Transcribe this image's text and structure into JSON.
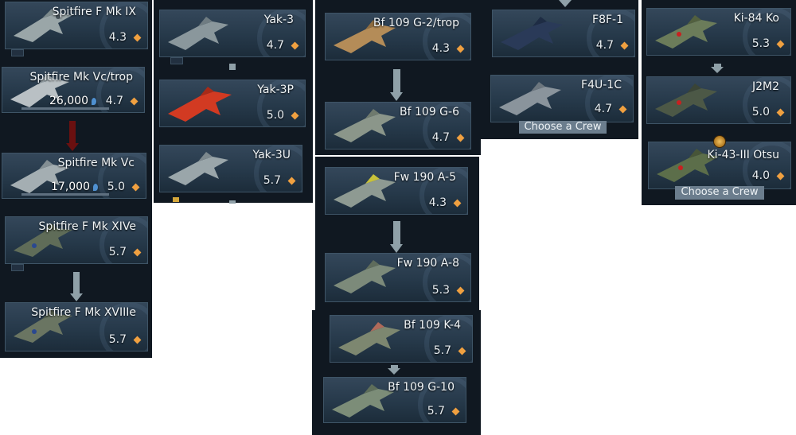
{
  "colors": {
    "panel_bg": "#101821",
    "card_bg": "#2a3c4d",
    "diamond": "#f0a040",
    "arrow": "#8fa0a8",
    "arrow_researching": "#6a1010",
    "crew_button": "#6b7d8d"
  },
  "icons": {
    "br": "diamond-icon",
    "research_point": "research-point-icon"
  },
  "columns": {
    "britain": [
      {
        "name": "Spitfire F Mk IX",
        "br": "4.3"
      },
      {
        "name": "Spitfire Mk Vc/trop",
        "br": "4.7",
        "cost": "26,000"
      },
      {
        "name": "Spitfire Mk Vc",
        "br": "5.0",
        "cost": "17,000"
      },
      {
        "name": "Spitfire F Mk XIVe",
        "br": "5.7"
      },
      {
        "name": "Spitfire F Mk XVIIIe",
        "br": "5.7"
      }
    ],
    "ussr": [
      {
        "name": "Yak-3",
        "br": "4.7"
      },
      {
        "name": "Yak-3P",
        "br": "5.0"
      },
      {
        "name": "Yak-3U",
        "br": "5.7"
      }
    ],
    "germany": [
      {
        "name": "Bf 109 G-2/trop",
        "br": "4.3"
      },
      {
        "name": "Bf 109 G-6",
        "br": "4.7"
      },
      {
        "name": "Fw 190 A-5",
        "br": "4.3"
      },
      {
        "name": "Fw 190 A-8",
        "br": "5.3"
      },
      {
        "name": "Bf 109 K-4",
        "br": "5.7"
      },
      {
        "name": "Bf 109 G-10",
        "br": "5.7"
      }
    ],
    "usa": [
      {
        "name": "F8F-1",
        "br": "4.7"
      },
      {
        "name": "F4U-1C",
        "br": "4.7",
        "crew_button": "Choose a Crew"
      }
    ],
    "japan": [
      {
        "name": "Ki-84 Ko",
        "br": "5.3"
      },
      {
        "name": "J2M2",
        "br": "5.0"
      },
      {
        "name": "Ki-43-III Otsu",
        "br": "4.0",
        "crew_button": "Choose a Crew"
      }
    ]
  }
}
